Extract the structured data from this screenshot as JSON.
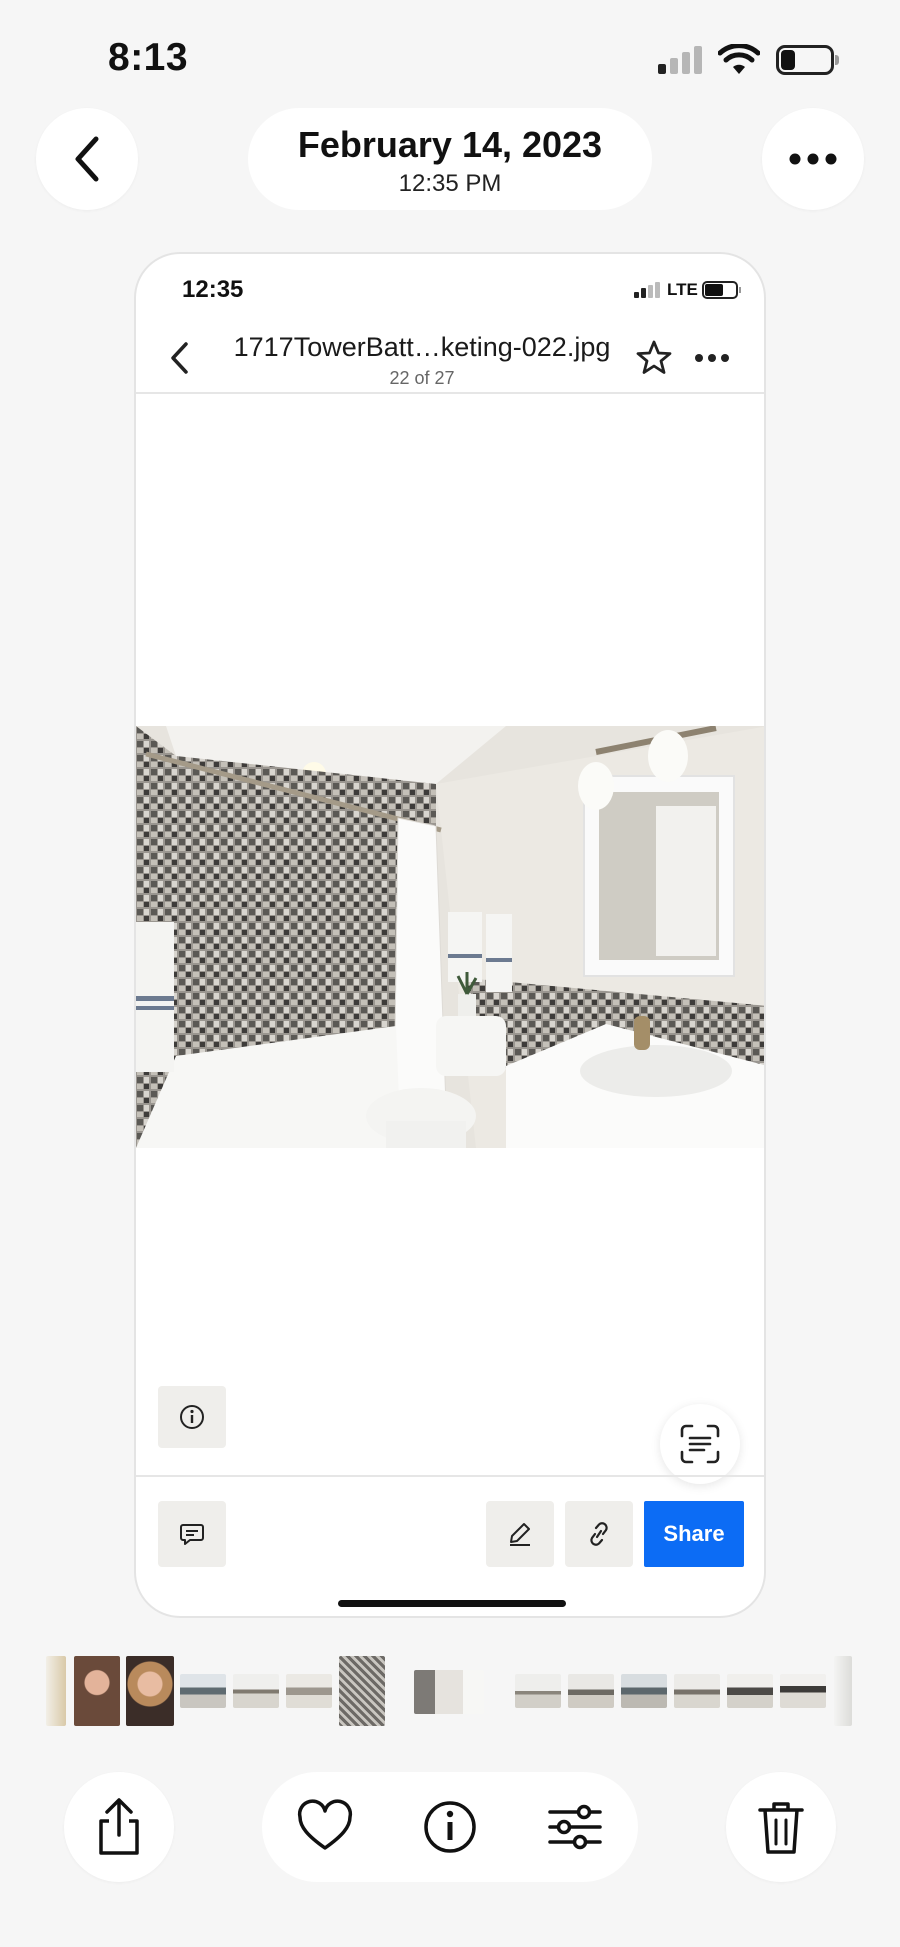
{
  "status_bar": {
    "time": "8:13"
  },
  "header": {
    "back_icon": "chevron-left-icon",
    "date": "February 14, 2023",
    "time": "12:35 PM",
    "more_icon": "ellipsis-icon"
  },
  "screenshot": {
    "status_bar": {
      "time": "12:35",
      "network": "LTE"
    },
    "file_name": "1717TowerBatt…keting-022.jpg",
    "file_position": "22 of 27",
    "photo": "bathroom with mosaic tile shower, white vanity, toilet and mirror",
    "toolbar": {
      "info_icon": "info-icon",
      "comment_icon": "comment-icon",
      "edit_icon": "pencil-icon",
      "link_icon": "link-icon",
      "share_label": "Share",
      "scan_icon": "scan-text-icon"
    }
  },
  "bottom_toolbar": {
    "share_icon": "share-icon",
    "favorite_icon": "heart-icon",
    "info_icon": "info-icon",
    "adjust_icon": "sliders-icon",
    "delete_icon": "trash-icon"
  },
  "colors": {
    "accent": "#0c6cf5",
    "background": "#f6f6f6"
  }
}
